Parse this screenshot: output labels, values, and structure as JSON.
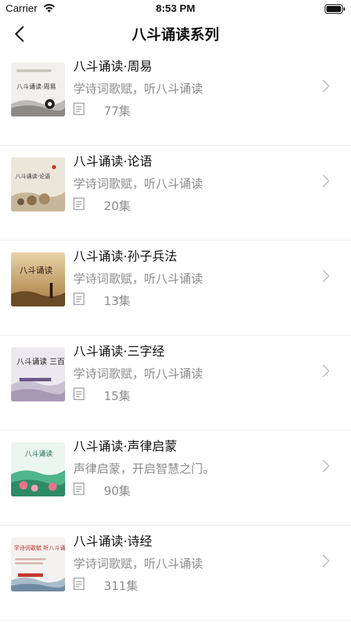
{
  "status": {
    "carrier": "Carrier",
    "time": "8:53 PM"
  },
  "nav": {
    "title": "八斗诵读系列"
  },
  "items": [
    {
      "title": "八斗诵读·周易",
      "subtitle": "学诗词歌赋，听八斗诵读",
      "count": "77集",
      "cover_text": "八斗诵读·周易"
    },
    {
      "title": "八斗诵读·论语",
      "subtitle": "学诗词歌赋，听八斗诵读",
      "count": "20集",
      "cover_text": "八斗诵读·论语"
    },
    {
      "title": "八斗诵读·孙子兵法",
      "subtitle": "学诗词歌赋，听八斗诵读",
      "count": "13集",
      "cover_text": "八斗诵读"
    },
    {
      "title": "八斗诵读·三字经",
      "subtitle": "学诗词歌赋，听八斗诵读",
      "count": "15集",
      "cover_text": "八斗诵读 三百千弟"
    },
    {
      "title": "八斗诵读·声律启蒙",
      "subtitle": "声律启蒙，开启智慧之门。",
      "count": "90集",
      "cover_text": "八斗诵读"
    },
    {
      "title": "八斗诵读·诗经",
      "subtitle": "学诗词歌赋，听八斗诵读",
      "count": "311集",
      "cover_text": "学诗词歌赋 听八斗诵读"
    }
  ]
}
